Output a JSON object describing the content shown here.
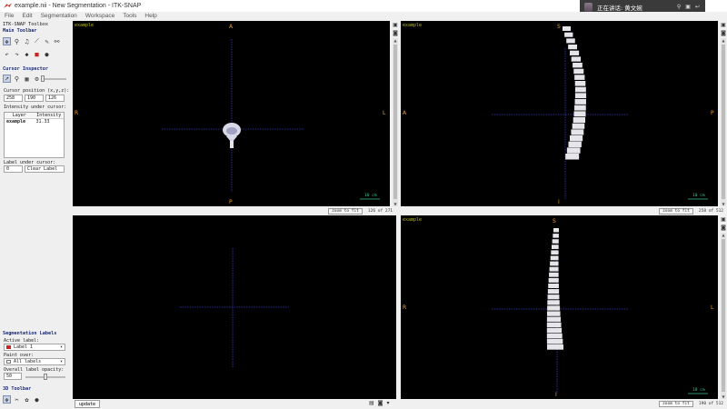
{
  "window": {
    "title": "example.nii - New Segmentation - ITK-SNAP"
  },
  "notification": {
    "text": "正在讲话: 黄文婉",
    "buttons": [
      "⚲",
      "▣",
      "↩"
    ]
  },
  "menu": [
    "File",
    "Edit",
    "Segmentation",
    "Workspace",
    "Tools",
    "Help"
  ],
  "left": {
    "toolbox_title": "ITK-SNAP Toolbox",
    "main_toolbar": "Main Toolbar",
    "main_tools": [
      "crosshair",
      "zoom",
      "paintbrush",
      "polygon",
      "snake",
      "annotate"
    ],
    "undo_redo": [
      "undo",
      "redo"
    ],
    "cursor_inspector": "Cursor Inspector",
    "cursor_position_label": "Cursor position (x,y,z):",
    "cursor_position": [
      "258",
      "190",
      "126"
    ],
    "intensity_label": "Intensity under cursor:",
    "table_headers": [
      "Layer",
      "Intensity"
    ],
    "table_rows": [
      [
        "example",
        "31.33"
      ]
    ],
    "label_under_cursor": "Label under cursor:",
    "label_value": "0",
    "label_name": "Clear Label",
    "seg_labels_title": "Segmentation Labels",
    "active_label_title": "Active label:",
    "active_label": "Label 1",
    "paint_over_title": "Paint over:",
    "paint_over": "All labels",
    "opacity_title": "Overall label opacity:",
    "opacity_value": "50",
    "opacity_fraction": 0.5,
    "toolbar_3d": "3D Toolbar"
  },
  "viewports": {
    "axial": {
      "tag": "example",
      "top": "A",
      "bottom": "P",
      "left": "R",
      "right": "L",
      "scale": "10 cm",
      "zoom_btn": "zoom to fit",
      "slice": "126 of 271"
    },
    "sagittal": {
      "tag": "example",
      "top": "S",
      "bottom": "I",
      "left": "A",
      "right": "P",
      "scale": "10 cm",
      "zoom_btn": "zoom to fit",
      "slice": "258 of 512"
    },
    "empty": {
      "tag": ""
    },
    "coronal": {
      "tag": "example",
      "top": "S",
      "bottom": "I",
      "left": "R",
      "right": "L",
      "scale": "10 cm",
      "zoom_btn": "zoom to fit",
      "slice": "190 of 512"
    }
  },
  "bottom": {
    "update": "update"
  },
  "colors": {
    "crosshair": "#3b3bbf",
    "orient": "#e8a030",
    "tag": "#b8b820",
    "bone": "#e6e6ea"
  }
}
